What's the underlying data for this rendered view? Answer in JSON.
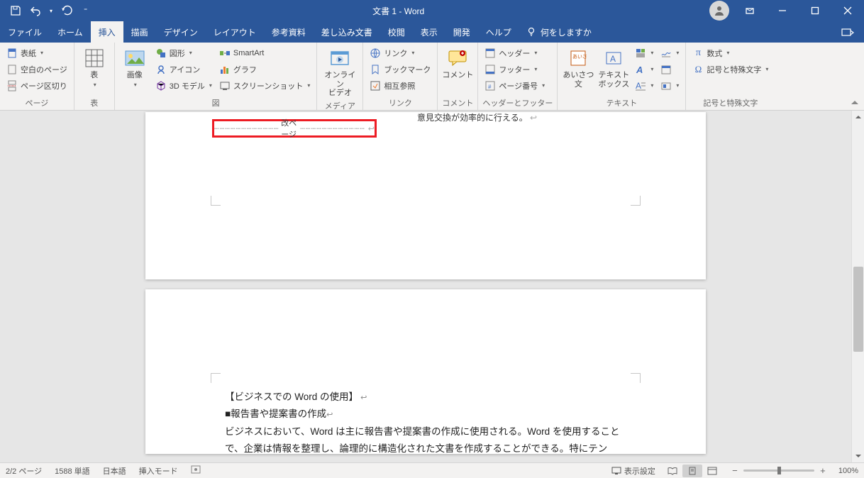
{
  "title": "文書 1  -  Word",
  "tabs": [
    "ファイル",
    "ホーム",
    "挿入",
    "描画",
    "デザイン",
    "レイアウト",
    "参考資料",
    "差し込み文書",
    "校閲",
    "表示",
    "開発",
    "ヘルプ"
  ],
  "active_tab": 2,
  "tell_me": "何をしますか",
  "ribbon": {
    "pages": {
      "label": "ページ",
      "cover": "表紙",
      "blank": "空白のページ",
      "break": "ページ区切り"
    },
    "tables": {
      "label": "表",
      "table": "表"
    },
    "illust": {
      "label": "図",
      "image": "画像",
      "shapes": "図形",
      "icons": "アイコン",
      "model3d": "3D モデル",
      "smartart": "SmartArt",
      "chart": "グラフ",
      "screenshot": "スクリーンショット"
    },
    "media": {
      "label": "メディア",
      "online_video": "オンライン\nビデオ"
    },
    "links": {
      "label": "リンク",
      "link": "リンク",
      "bookmark": "ブックマーク",
      "crossref": "相互参照"
    },
    "comments": {
      "label": "コメント",
      "comment": "コメント"
    },
    "hf": {
      "label": "ヘッダーとフッター",
      "header": "ヘッダー",
      "footer": "フッター",
      "pagenum": "ページ番号"
    },
    "text": {
      "label": "テキスト",
      "greeting": "あいさつ\n文",
      "textbox": "テキスト\nボックス"
    },
    "symbols": {
      "label": "記号と特殊文字",
      "equation": "数式",
      "symbol": "記号と特殊文字"
    }
  },
  "doc": {
    "overflow_text": "意見交換が効率的に行える。",
    "page_break": "改ページ",
    "page2_h1": "【ビジネスでの Word の使用】",
    "page2_h2": "■報告書や提案書の作成",
    "page2_p": "ビジネスにおいて、Word は主に報告書や提案書の作成に使用される。Word を使用することで、企業は情報を整理し、論理的に構造化された文書を作成することができる。特にテン"
  },
  "status": {
    "page": "2/2 ページ",
    "words": "1588 単語",
    "lang": "日本語",
    "mode": "挿入モード",
    "display_settings": "表示設定",
    "zoom": "100%"
  }
}
